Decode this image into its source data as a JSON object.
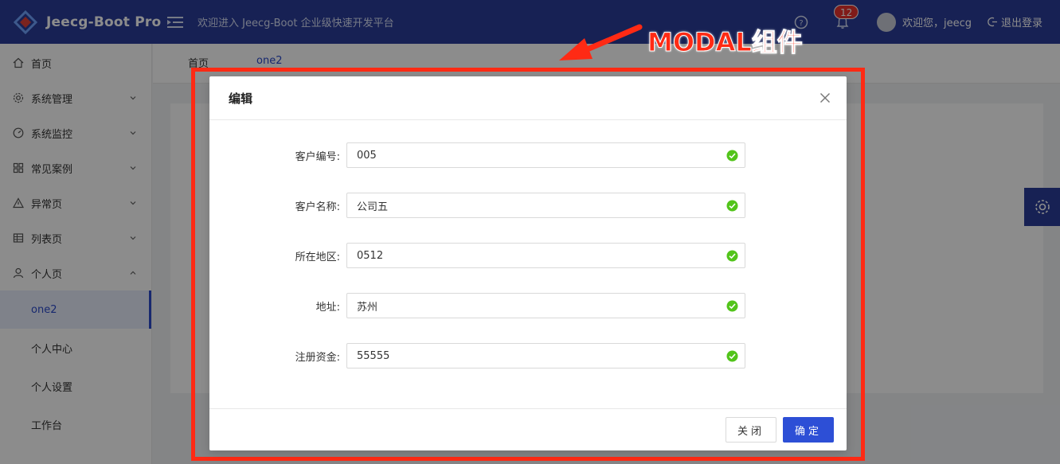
{
  "header": {
    "logo_text": "Jeecg-Boot Pro",
    "welcome_banner": "欢迎进入 Jeecg-Boot 企业级快速开发平台",
    "notification_count": "12",
    "user_greeting": "欢迎您，jeecg",
    "logout_label": "退出登录"
  },
  "sidebar": {
    "items": [
      {
        "label": "首页",
        "icon": "home-icon"
      },
      {
        "label": "系统管理",
        "icon": "gear-icon"
      },
      {
        "label": "系统监控",
        "icon": "dashboard-icon"
      },
      {
        "label": "常见案例",
        "icon": "grid-icon"
      },
      {
        "label": "异常页",
        "icon": "warning-icon"
      },
      {
        "label": "列表页",
        "icon": "table-icon"
      },
      {
        "label": "个人页",
        "icon": "user-icon"
      }
    ],
    "sub_items": [
      {
        "label": "one2",
        "active": true
      },
      {
        "label": "个人中心"
      },
      {
        "label": "个人设置"
      },
      {
        "label": "工作台"
      }
    ]
  },
  "tabs": [
    {
      "label": "首页"
    },
    {
      "label": "one2",
      "active": true
    }
  ],
  "annotation": "MODAL组件",
  "modal": {
    "title": "编辑",
    "fields": [
      {
        "label": "客户编号:",
        "value": "005"
      },
      {
        "label": "客户名称:",
        "value": "公司五"
      },
      {
        "label": "所在地区:",
        "value": "0512"
      },
      {
        "label": "地址:",
        "value": "苏州"
      },
      {
        "label": "注册资金:",
        "value": "55555"
      }
    ],
    "close_label": "关闭",
    "ok_label": "确定"
  },
  "colors": {
    "header_bg": "#2b3d9a",
    "primary": "#2d4fd6",
    "annotation_red": "#ff2a14",
    "success": "#52c41a"
  }
}
